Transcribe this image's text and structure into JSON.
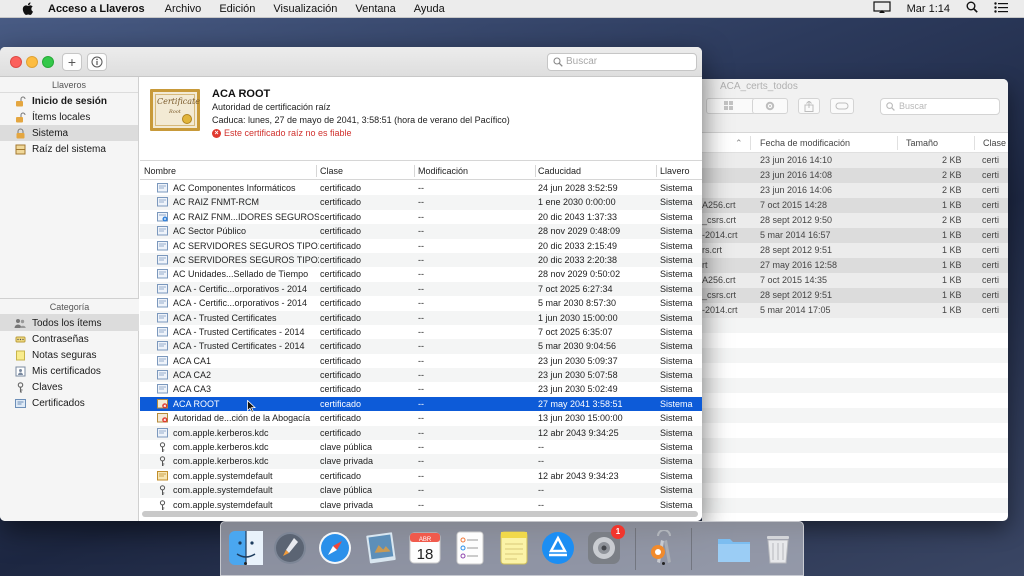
{
  "menubar": {
    "app_name": "Acceso a Llaveros",
    "items": [
      "Archivo",
      "Edición",
      "Visualización",
      "Ventana",
      "Ayuda"
    ],
    "clock": "Mar 1:14"
  },
  "finder": {
    "title": "ACA_certs_todos",
    "search_placeholder": "Buscar",
    "columns": [
      "Fecha de modificación",
      "Tamaño",
      "Clase"
    ],
    "rows": [
      {
        "name": "",
        "date": "23 jun 2016 14:10",
        "size": "2 KB",
        "kind": "certi"
      },
      {
        "name": "",
        "date": "23 jun 2016 14:08",
        "size": "2 KB",
        "kind": "certi"
      },
      {
        "name": "",
        "date": "23 jun 2016 14:06",
        "size": "2 KB",
        "kind": "certi"
      },
      {
        "name": "A256.crt",
        "date": "7 oct 2015 14:28",
        "size": "1 KB",
        "kind": "certi"
      },
      {
        "name": "_csrs.crt",
        "date": "28 sept 2012 9:50",
        "size": "2 KB",
        "kind": "certi"
      },
      {
        "name": "-2014.crt",
        "date": "5 mar 2014 16:57",
        "size": "1 KB",
        "kind": "certi"
      },
      {
        "name": "rs.crt",
        "date": "28 sept 2012 9:51",
        "size": "1 KB",
        "kind": "certi"
      },
      {
        "name": "rt",
        "date": "27 may 2016 12:58",
        "size": "1 KB",
        "kind": "certi"
      },
      {
        "name": "A256.crt",
        "date": "7 oct 2015 14:35",
        "size": "1 KB",
        "kind": "certi"
      },
      {
        "name": "_csrs.crt",
        "date": "28 sept 2012 9:51",
        "size": "1 KB",
        "kind": "certi"
      },
      {
        "name": "-2014.crt",
        "date": "5 mar 2014 17:05",
        "size": "1 KB",
        "kind": "certi"
      }
    ]
  },
  "sidebar": {
    "keychains_header": "Llaveros",
    "keychains": [
      {
        "label": "Inicio de sesión",
        "icon": "lock-open-icon",
        "bold": true
      },
      {
        "label": "Ítems locales",
        "icon": "lock-open-icon",
        "bold": false
      },
      {
        "label": "Sistema",
        "icon": "lock-icon",
        "bold": false,
        "selected": true
      },
      {
        "label": "Raíz del sistema",
        "icon": "cabinet-icon",
        "bold": false
      }
    ],
    "category_header": "Categoría",
    "categories": [
      {
        "label": "Todos los ítems",
        "icon": "people-icon",
        "selected": true
      },
      {
        "label": "Contraseñas",
        "icon": "password-icon"
      },
      {
        "label": "Notas seguras",
        "icon": "note-icon"
      },
      {
        "label": "Mis certificados",
        "icon": "my-cert-icon"
      },
      {
        "label": "Claves",
        "icon": "key-icon"
      },
      {
        "label": "Certificados",
        "icon": "certificate-icon"
      }
    ]
  },
  "toolbar": {
    "add_label": "+",
    "info_label": "i",
    "search_placeholder": "Buscar"
  },
  "detail": {
    "cert_word": "Certificate",
    "cert_word2": "Root",
    "name": "ACA ROOT",
    "kind": "Autoridad de certificación raíz",
    "expires": "Caduca: lunes, 27 de mayo de 2041, 3:58:51 (hora de verano del Pacífico)",
    "warning": "Este certificado raíz no es fiable"
  },
  "table": {
    "columns": {
      "name": "Nombre",
      "class": "Clase",
      "modified": "Modificación",
      "expires": "Caducidad",
      "keychain": "Llavero"
    },
    "rows": [
      {
        "name": "AC Componentes Informáticos",
        "class": "certificado",
        "mod": "--",
        "exp": "24 jun 2028 3:52:59",
        "kc": "Sistema",
        "icon": "cert"
      },
      {
        "name": "AC RAIZ FNMT-RCM",
        "class": "certificado",
        "mod": "--",
        "exp": "1 ene 2030 0:00:00",
        "kc": "Sistema",
        "icon": "cert"
      },
      {
        "name": "AC RAIZ FNM...IDORES SEGUROS",
        "class": "certificado",
        "mod": "--",
        "exp": "20 dic 2043 1:37:33",
        "kc": "Sistema",
        "icon": "cert-blue"
      },
      {
        "name": "AC Sector Público",
        "class": "certificado",
        "mod": "--",
        "exp": "28 nov 2029 0:48:09",
        "kc": "Sistema",
        "icon": "cert"
      },
      {
        "name": "AC SERVIDORES SEGUROS TIPO1",
        "class": "certificado",
        "mod": "--",
        "exp": "20 dic 2033 2:15:49",
        "kc": "Sistema",
        "icon": "cert"
      },
      {
        "name": "AC SERVIDORES SEGUROS TIPO2",
        "class": "certificado",
        "mod": "--",
        "exp": "20 dic 2033 2:20:38",
        "kc": "Sistema",
        "icon": "cert"
      },
      {
        "name": "AC Unidades...Sellado de Tiempo",
        "class": "certificado",
        "mod": "--",
        "exp": "28 nov 2029 0:50:02",
        "kc": "Sistema",
        "icon": "cert"
      },
      {
        "name": "ACA - Certific...orporativos - 2014",
        "class": "certificado",
        "mod": "--",
        "exp": "7 oct 2025 6:27:34",
        "kc": "Sistema",
        "icon": "cert"
      },
      {
        "name": "ACA - Certific...orporativos - 2014",
        "class": "certificado",
        "mod": "--",
        "exp": "5 mar 2030 8:57:30",
        "kc": "Sistema",
        "icon": "cert"
      },
      {
        "name": "ACA - Trusted Certificates",
        "class": "certificado",
        "mod": "--",
        "exp": "1 jun 2030 15:00:00",
        "kc": "Sistema",
        "icon": "cert"
      },
      {
        "name": "ACA - Trusted Certificates - 2014",
        "class": "certificado",
        "mod": "--",
        "exp": "7 oct 2025 6:35:07",
        "kc": "Sistema",
        "icon": "cert"
      },
      {
        "name": "ACA - Trusted Certificates - 2014",
        "class": "certificado",
        "mod": "--",
        "exp": "5 mar 2030 9:04:56",
        "kc": "Sistema",
        "icon": "cert"
      },
      {
        "name": "ACA CA1",
        "class": "certificado",
        "mod": "--",
        "exp": "23 jun 2030 5:09:37",
        "kc": "Sistema",
        "icon": "cert"
      },
      {
        "name": "ACA CA2",
        "class": "certificado",
        "mod": "--",
        "exp": "23 jun 2030 5:07:58",
        "kc": "Sistema",
        "icon": "cert"
      },
      {
        "name": "ACA CA3",
        "class": "certificado",
        "mod": "--",
        "exp": "23 jun 2030 5:02:49",
        "kc": "Sistema",
        "icon": "cert"
      },
      {
        "name": "ACA ROOT",
        "class": "certificado",
        "mod": "--",
        "exp": "27 may 2041 3:58:51",
        "kc": "Sistema",
        "icon": "cert-red",
        "selected": true
      },
      {
        "name": "Autoridad de...ción de la Abogacía",
        "class": "certificado",
        "mod": "--",
        "exp": "13 jun 2030 15:00:00",
        "kc": "Sistema",
        "icon": "cert-red"
      },
      {
        "name": "com.apple.kerberos.kdc",
        "class": "certificado",
        "mod": "--",
        "exp": "12 abr 2043 9:34:25",
        "kc": "Sistema",
        "icon": "cert"
      },
      {
        "name": "com.apple.kerberos.kdc",
        "class": "clave pública",
        "mod": "--",
        "exp": "--",
        "kc": "Sistema",
        "icon": "key"
      },
      {
        "name": "com.apple.kerberos.kdc",
        "class": "clave privada",
        "mod": "--",
        "exp": "--",
        "kc": "Sistema",
        "icon": "key"
      },
      {
        "name": "com.apple.systemdefault",
        "class": "certificado",
        "mod": "--",
        "exp": "12 abr 2043 9:34:23",
        "kc": "Sistema",
        "icon": "cert-gold"
      },
      {
        "name": "com.apple.systemdefault",
        "class": "clave pública",
        "mod": "--",
        "exp": "--",
        "kc": "Sistema",
        "icon": "key"
      },
      {
        "name": "com.apple.systemdefault",
        "class": "clave privada",
        "mod": "--",
        "exp": "--",
        "kc": "Sistema",
        "icon": "key"
      }
    ]
  },
  "dock": {
    "calendar_month": "ABR",
    "calendar_day": "18",
    "update_badge": "1",
    "apps": [
      "finder-icon",
      "launchpad-icon",
      "safari-icon",
      "preview-icon",
      "calendar-icon",
      "reminders-icon",
      "notes-icon",
      "app-store-icon",
      "system-preferences-icon",
      "keychain-access-icon",
      "downloads-folder-icon",
      "trash-icon"
    ]
  }
}
